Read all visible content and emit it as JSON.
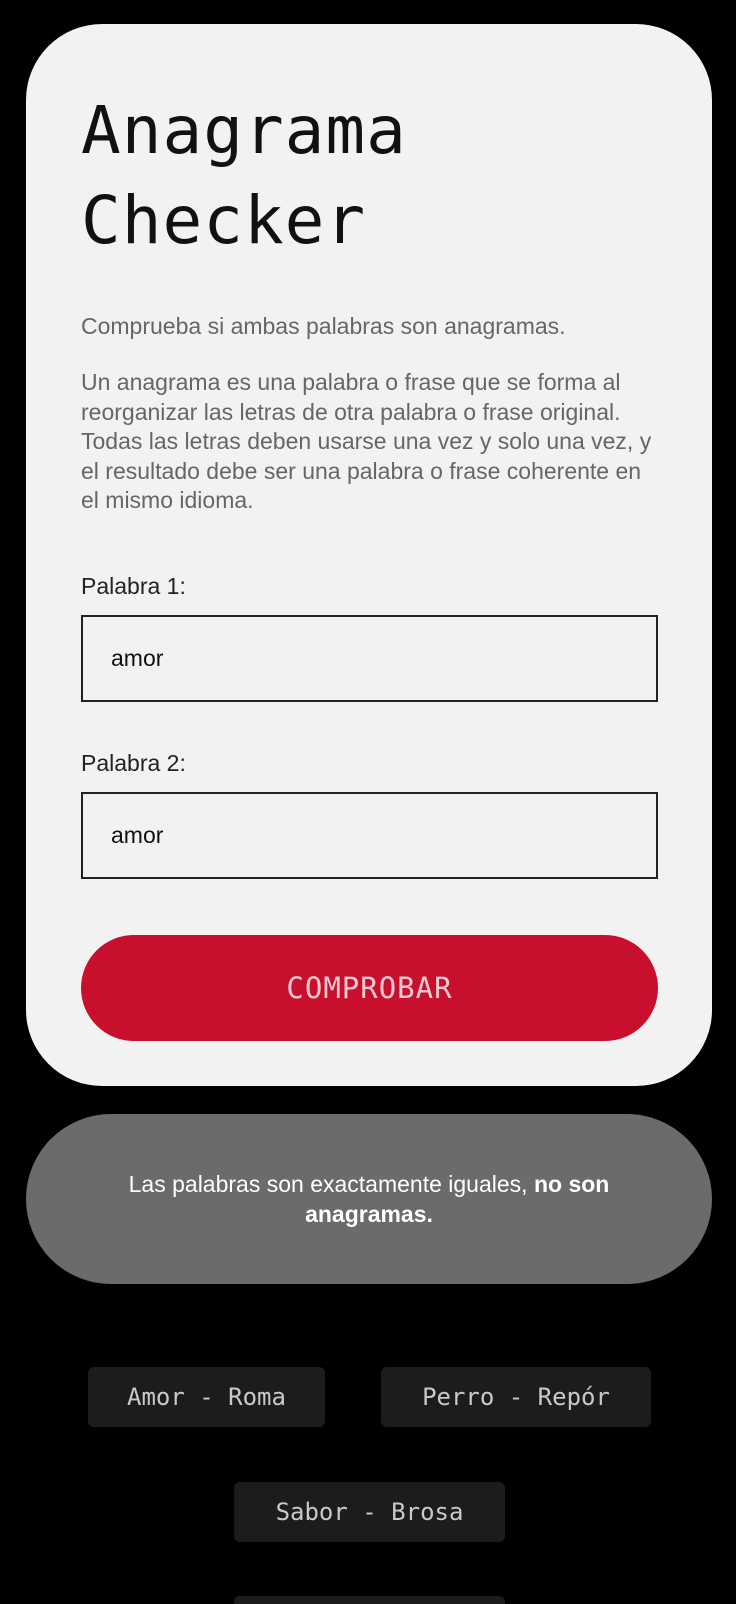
{
  "card": {
    "title_line1": "Anagrama",
    "title_line2": "Checker",
    "subtitle": "Comprueba si ambas palabras son anagramas.",
    "description": "Un anagrama es una palabra o frase que se forma al reorganizar las letras de otra palabra o frase original. Todas las letras deben usarse una vez y solo una vez, y el resultado debe ser una palabra o frase coherente en el mismo idioma.",
    "field1_label": "Palabra 1:",
    "field1_value": "amor",
    "field2_label": "Palabra 2:",
    "field2_value": "amor",
    "submit_label": "COMPROBAR"
  },
  "result": {
    "text": "Las palabras son exactamente iguales, ",
    "emphasis": "no son anagramas."
  },
  "examples": [
    "Amor - Roma",
    "Perro - Repór",
    "Sabor - Brosa"
  ],
  "colors": {
    "background": "#000000",
    "card": "#f2f2f2",
    "accent": "#c8102e",
    "result": "#6b6b6b",
    "chip": "#1c1c1c"
  }
}
